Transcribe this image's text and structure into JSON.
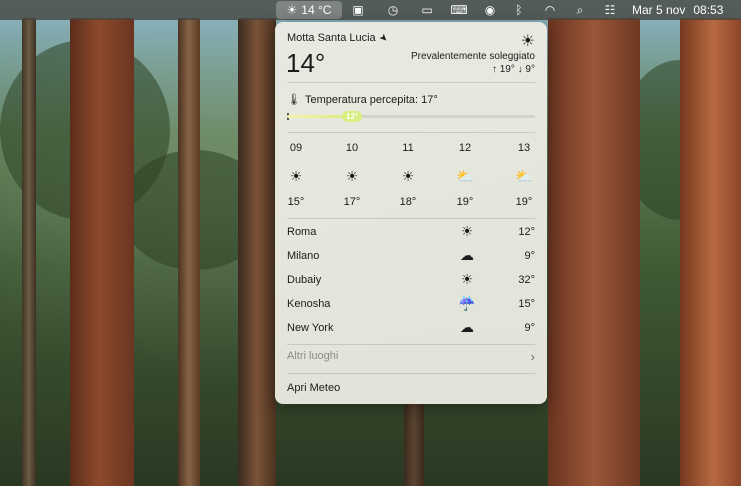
{
  "menubar": {
    "weather_icon": "sun-icon",
    "weather_temp": "14 °C",
    "date": "Mar 5 nov",
    "time": "08:53",
    "icons": [
      "stage-manager-icon",
      "time-machine-icon",
      "display-icon",
      "keyboard-icon",
      "user-icon",
      "bluetooth-icon",
      "wifi-icon",
      "spotlight-icon",
      "control-center-icon"
    ]
  },
  "weather": {
    "location": "Motta Santa Lucia",
    "temperature": "14°",
    "condition": "Prevalentemente soleggiato",
    "high": "↑ 19°",
    "low": "↓ 9°",
    "feels_like": "Temperatura percepita: 17°",
    "feels_value": "13°",
    "feels_level": 0.27,
    "hourly": [
      {
        "hour": "09",
        "icon": "sun-icon",
        "temp": "15°"
      },
      {
        "hour": "10",
        "icon": "sun-icon",
        "temp": "17°"
      },
      {
        "hour": "11",
        "icon": "sun-icon",
        "temp": "18°"
      },
      {
        "hour": "12",
        "icon": "partly-cloudy-icon",
        "temp": "19°"
      },
      {
        "hour": "13",
        "icon": "partly-cloudy-icon",
        "temp": "19°"
      }
    ],
    "cities": [
      {
        "name": "Roma",
        "icon": "sun-icon",
        "temp": "12°"
      },
      {
        "name": "Milano",
        "icon": "cloud-icon",
        "temp": "9°"
      },
      {
        "name": "Dubaiy",
        "icon": "sun-icon",
        "temp": "32°"
      },
      {
        "name": "Kenosha",
        "icon": "rain-cloud-icon",
        "temp": "15°"
      },
      {
        "name": "New York",
        "icon": "cloud-icon",
        "temp": "9°"
      }
    ],
    "more_places": "Altri luoghi",
    "open_app": "Apri Meteo"
  }
}
